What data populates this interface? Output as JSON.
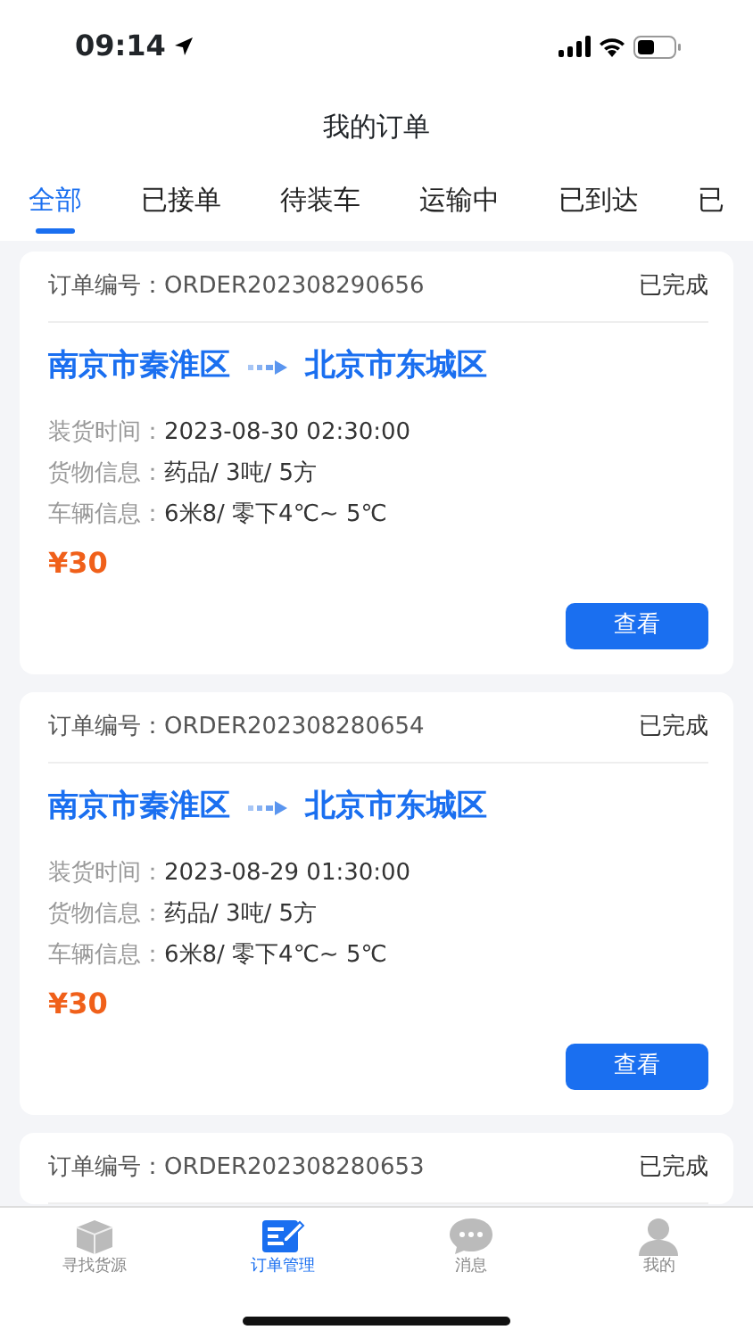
{
  "status_bar": {
    "time": "09:14"
  },
  "title": "我的订单",
  "tabs": [
    {
      "label": "全部",
      "selected": true
    },
    {
      "label": "已接单",
      "selected": false
    },
    {
      "label": "待装车",
      "selected": false
    },
    {
      "label": "运输中",
      "selected": false
    },
    {
      "label": "已到达",
      "selected": false
    },
    {
      "label": "已",
      "selected": false
    }
  ],
  "orders": [
    {
      "order_no": "订单编号：ORDER202308290656",
      "status": "已完成",
      "from": "南京市秦淮区",
      "to": "北京市东城区",
      "info": [
        {
          "label": "装货时间：",
          "value": "2023-08-30 02:30:00"
        },
        {
          "label": "货物信息：",
          "value": "药品/ 3吨/ 5方"
        },
        {
          "label": "车辆信息：",
          "value": "6米8/ 零下4℃~ 5℃"
        }
      ],
      "price": "¥30",
      "button": "查看"
    },
    {
      "order_no": "订单编号：ORDER202308280654",
      "status": "已完成",
      "from": "南京市秦淮区",
      "to": "北京市东城区",
      "info": [
        {
          "label": "装货时间：",
          "value": "2023-08-29 01:30:00"
        },
        {
          "label": "货物信息：",
          "value": "药品/ 3吨/ 5方"
        },
        {
          "label": "车辆信息：",
          "value": "6米8/ 零下4℃~ 5℃"
        }
      ],
      "price": "¥30",
      "button": "查看"
    },
    {
      "order_no": "订单编号：ORDER202308280653",
      "status": "已完成"
    }
  ],
  "bottom_nav": [
    {
      "label": "寻找货源",
      "kind": "box",
      "selected": false
    },
    {
      "label": "订单管理",
      "kind": "edit",
      "selected": true
    },
    {
      "label": "消息",
      "kind": "chat",
      "selected": false
    },
    {
      "label": "我的",
      "kind": "person",
      "selected": false
    }
  ]
}
